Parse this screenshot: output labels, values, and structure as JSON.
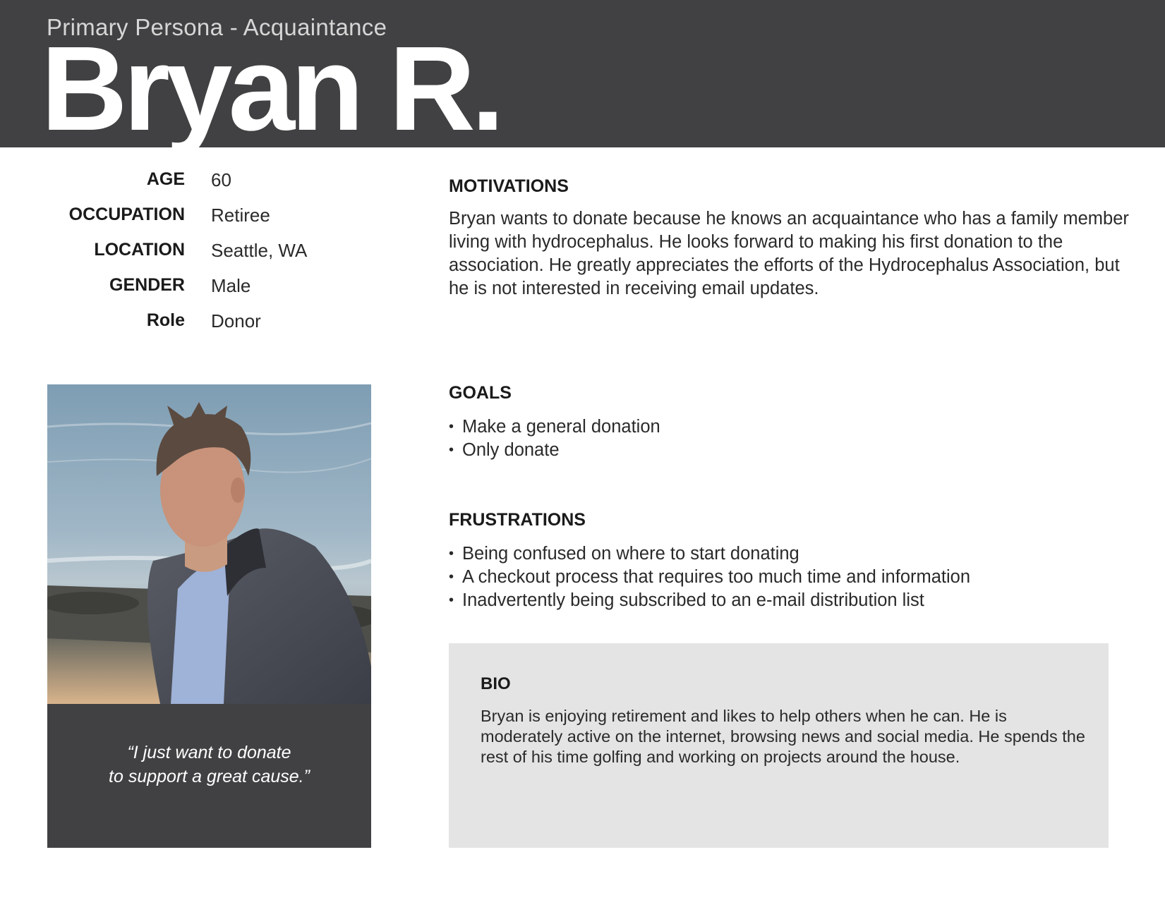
{
  "header": {
    "subtitle": "Primary Persona - Acquaintance",
    "name": "Bryan R.",
    "background_color": "#414143"
  },
  "attributes": [
    {
      "label": "AGE",
      "value": "60"
    },
    {
      "label": "OCCUPATION",
      "value": "Retiree"
    },
    {
      "label": "LOCATION",
      "value": "Seattle, WA"
    },
    {
      "label": "GENDER",
      "value": "Male"
    },
    {
      "label": "Role",
      "value": "Donor"
    }
  ],
  "photo": {
    "quote_line1": "“I just want to donate",
    "quote_line2": "to support a great cause.”"
  },
  "motivations": {
    "title": "MOTIVATIONS",
    "text": "Bryan wants to donate because he knows an acquaintance who has a family member living with hydrocephalus. He looks forward to making his first donation to the association. He greatly appreciates the efforts of the Hydrocephalus Association, but he is not interested in receiving email updates."
  },
  "goals": {
    "title": "GOALS",
    "items": [
      "Make a general donation",
      "Only donate"
    ]
  },
  "frustrations": {
    "title": "FRUSTRATIONS",
    "items": [
      "Being confused on where to start donating",
      "A checkout process that requires too much time and information",
      "Inadvertently being subscribed to an e-mail distribution list"
    ]
  },
  "bio": {
    "title": "BIO",
    "text": "Bryan is enjoying retirement and likes to help others when he can.  He is moderately active on the internet, browsing news and social media.  He spends the rest of his time golfing and working on projects around the house.",
    "background_color": "#e4e4e4"
  }
}
